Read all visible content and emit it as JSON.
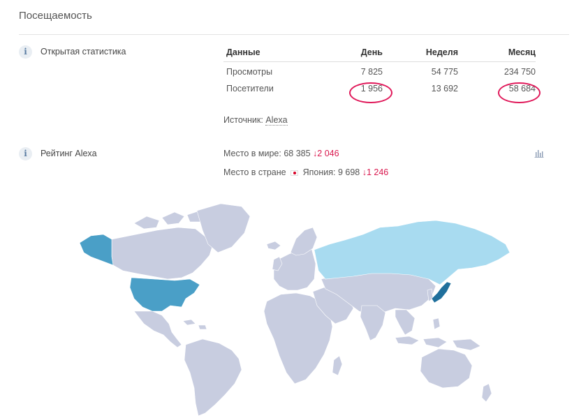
{
  "section": {
    "title": "Посещаемость"
  },
  "open_stats": {
    "icon": "info-icon",
    "label": "Открытая статистика",
    "headers": [
      "Данные",
      "День",
      "Неделя",
      "Месяц"
    ],
    "rows": [
      {
        "name": "Просмотры",
        "day": "7 825",
        "week": "54 775",
        "month": "234 750"
      },
      {
        "name": "Посетители",
        "day": "1 956",
        "week": "13 692",
        "month": "58 684"
      }
    ],
    "source_label": "Источник:",
    "source_link": "Alexa",
    "highlight_color": "#e0195a"
  },
  "alexa_rank": {
    "icon": "info-icon",
    "label": "Рейтинг Alexa",
    "world_label": "Место в мире:",
    "world_value": "68 385",
    "world_delta": "2 046",
    "country_label": "Место в стране",
    "country_name": "Япония:",
    "country_value": "9 698",
    "country_delta": "1 246",
    "delta_color": "#d9184e",
    "chart_icon": "bar-chart-icon"
  },
  "map": {
    "colors": {
      "default": "#c8cde0",
      "russia": "#a8dbf0",
      "usa": "#4a9fc7",
      "japan": "#1f6f9c"
    }
  }
}
